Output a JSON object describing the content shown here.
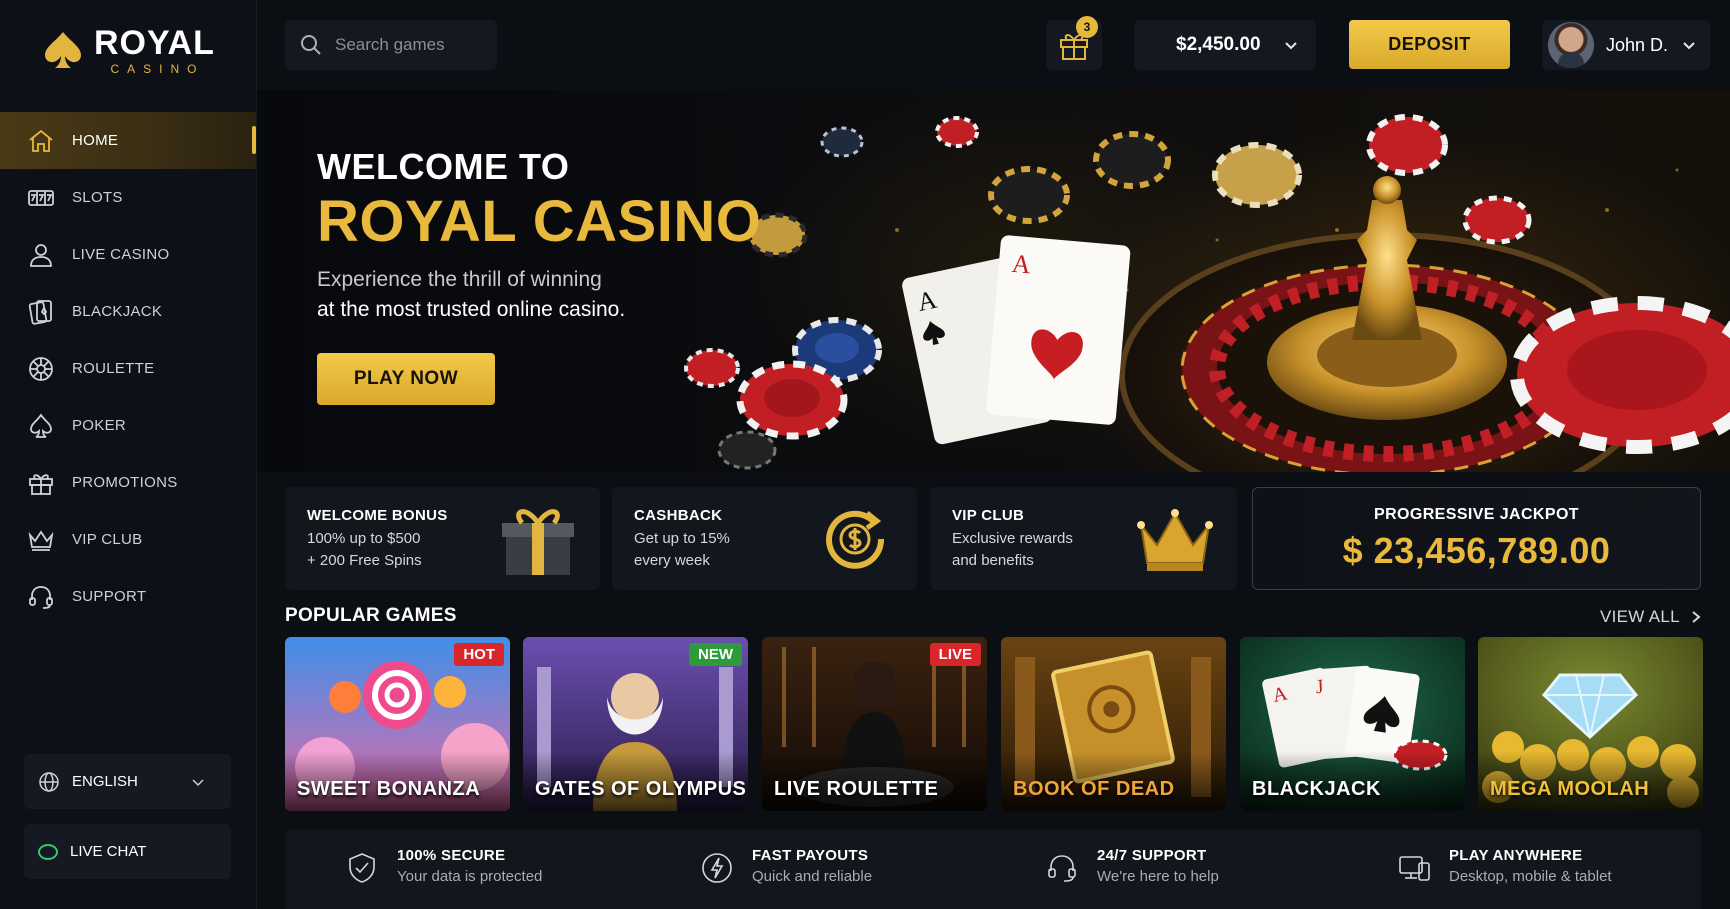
{
  "brand": {
    "name": "ROYAL",
    "sub": "CASINO"
  },
  "search": {
    "placeholder": "Search games"
  },
  "header": {
    "gift_badge": "3",
    "balance": "$2,450.00",
    "deposit_label": "DEPOSIT",
    "user_name": "John D."
  },
  "nav": {
    "items": [
      {
        "label": "HOME",
        "icon": "home-icon"
      },
      {
        "label": "SLOTS",
        "icon": "slots-icon"
      },
      {
        "label": "LIVE CASINO",
        "icon": "user-icon"
      },
      {
        "label": "BLACKJACK",
        "icon": "cards-icon"
      },
      {
        "label": "ROULETTE",
        "icon": "roulette-icon"
      },
      {
        "label": "POKER",
        "icon": "spade-icon"
      },
      {
        "label": "PROMOTIONS",
        "icon": "gift-icon"
      },
      {
        "label": "VIP CLUB",
        "icon": "crown-icon"
      },
      {
        "label": "SUPPORT",
        "icon": "headset-icon"
      }
    ],
    "language": "ENGLISH",
    "live_chat": "LIVE CHAT"
  },
  "hero": {
    "line1": "WELCOME TO",
    "line2": "ROYAL CASINO",
    "sub1": "Experience the thrill of winning",
    "sub2": "at the most trusted online casino.",
    "cta": "PLAY NOW",
    "card_rank": "A"
  },
  "promos": [
    {
      "title": "WELCOME BONUS",
      "line1": "100% up to $500",
      "line2": "+ 200 Free Spins",
      "icon": "gift-box-icon"
    },
    {
      "title": "CASHBACK",
      "line1": "Get up to 15%",
      "line2": "every week",
      "icon": "cashback-icon"
    },
    {
      "title": "VIP CLUB",
      "line1": "Exclusive rewards",
      "line2": "and benefits",
      "icon": "crown-icon"
    }
  ],
  "jackpot": {
    "title": "PROGRESSIVE JACKPOT",
    "amount": "$ 23,456,789.00"
  },
  "popular": {
    "title": "POPULAR GAMES",
    "view_all": "VIEW ALL",
    "games": [
      {
        "name": "SWEET BONANZA",
        "tag": "HOT",
        "tag_color": "#d8262b"
      },
      {
        "name": "GATES OF OLYMPUS",
        "tag": "NEW",
        "tag_color": "#2e9a3c"
      },
      {
        "name": "LIVE ROULETTE",
        "tag": "LIVE",
        "tag_color": "#d8262b"
      },
      {
        "name": "BOOK OF DEAD",
        "tag": "",
        "tag_color": ""
      },
      {
        "name": "BLACKJACK",
        "tag": "",
        "tag_color": ""
      },
      {
        "name": "MEGA MOOLAH",
        "tag": "",
        "tag_color": ""
      }
    ]
  },
  "features": [
    {
      "title": "100% SECURE",
      "sub": "Your data is protected",
      "icon": "shield-icon"
    },
    {
      "title": "FAST PAYOUTS",
      "sub": "Quick and reliable",
      "icon": "bolt-icon"
    },
    {
      "title": "24/7 SUPPORT",
      "sub": "We're here to help",
      "icon": "headset-icon"
    },
    {
      "title": "PLAY ANYWHERE",
      "sub": "Desktop, mobile & tablet",
      "icon": "devices-icon"
    }
  ],
  "colors": {
    "gold": "#e8b93c",
    "hot": "#d8262b",
    "new": "#2e9a3c",
    "bg": "#0b0e13"
  }
}
